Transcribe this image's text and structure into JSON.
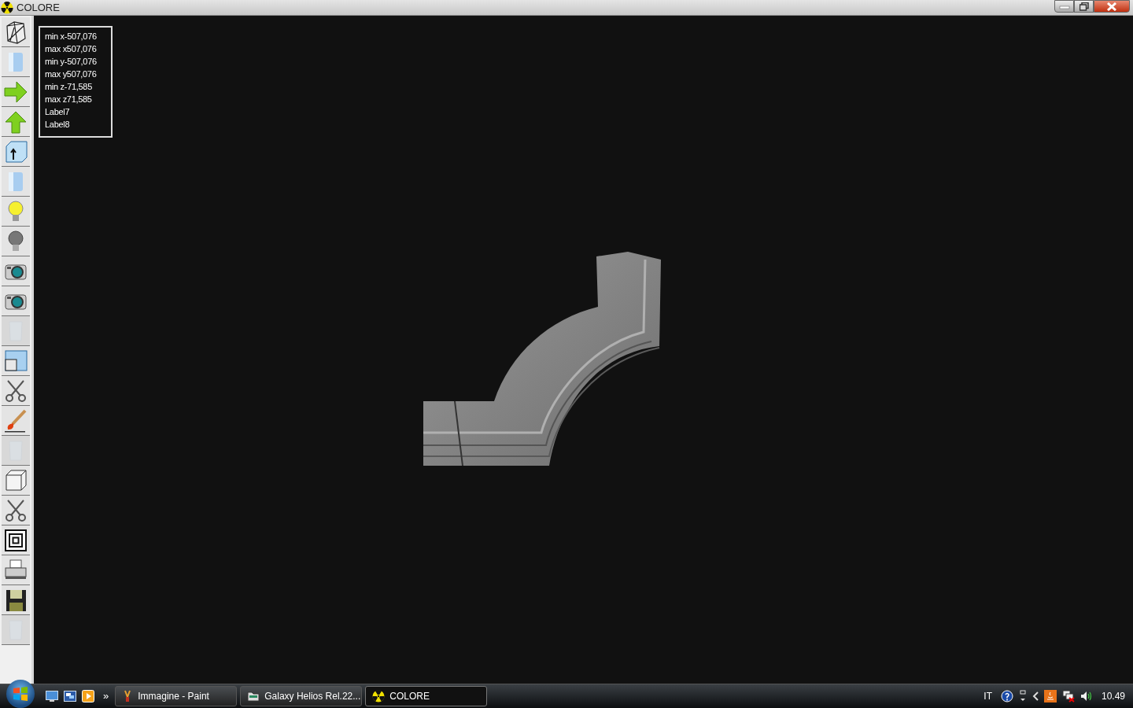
{
  "window": {
    "title": "COLORE"
  },
  "toolbar": [
    {
      "kind": "wireframe",
      "disabled": false
    },
    {
      "kind": "cylinder",
      "disabled": false
    },
    {
      "kind": "arrow-right",
      "disabled": false
    },
    {
      "kind": "arrow-up",
      "disabled": false
    },
    {
      "kind": "box-up",
      "disabled": false
    },
    {
      "kind": "cylinder",
      "disabled": false
    },
    {
      "kind": "bulb-on",
      "disabled": false
    },
    {
      "kind": "bulb-off",
      "disabled": false
    },
    {
      "kind": "camera",
      "disabled": false
    },
    {
      "kind": "camera",
      "disabled": false
    },
    {
      "kind": "glass",
      "disabled": true
    },
    {
      "kind": "windows",
      "disabled": false
    },
    {
      "kind": "scissors",
      "disabled": false
    },
    {
      "kind": "brush",
      "disabled": false
    },
    {
      "kind": "glass",
      "disabled": true
    },
    {
      "kind": "cube",
      "disabled": false
    },
    {
      "kind": "scissors",
      "disabled": false
    },
    {
      "kind": "target",
      "disabled": false
    },
    {
      "kind": "printer",
      "disabled": false
    },
    {
      "kind": "floppy",
      "disabled": false
    },
    {
      "kind": "glass",
      "disabled": true
    }
  ],
  "info_labels": [
    "min x-507,076",
    "max x507,076",
    "min y-507,076",
    "max y507,076",
    "min z-71,585",
    "max z71,585",
    "Label7",
    "Label8"
  ],
  "taskbar": {
    "overflow": "»",
    "tasks": [
      {
        "label": "Immagine - Paint",
        "kind": "paint",
        "selected": false
      },
      {
        "label": "Galaxy Helios  Rel.22...",
        "kind": "folder",
        "selected": false
      },
      {
        "label": "COLORE",
        "kind": "radiation",
        "selected": true
      }
    ],
    "language": "IT",
    "clock": "10.49"
  }
}
